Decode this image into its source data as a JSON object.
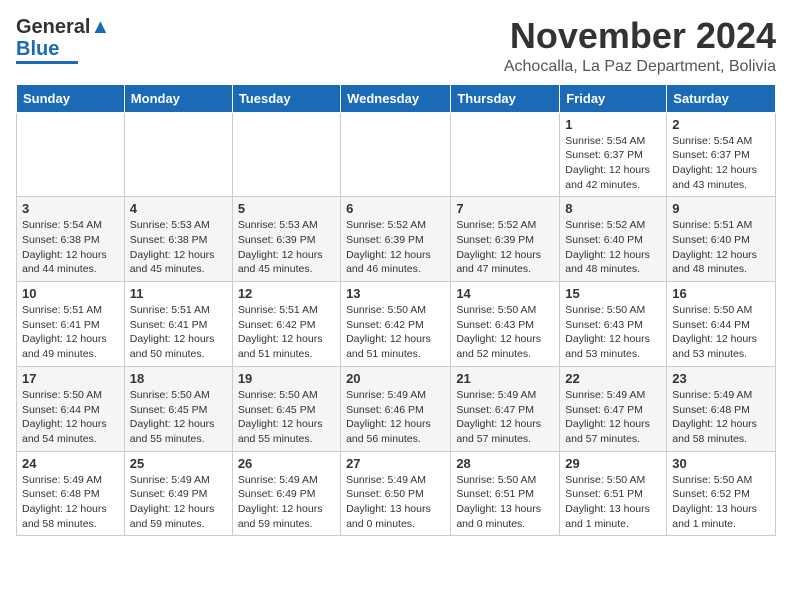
{
  "header": {
    "logo_general": "General",
    "logo_blue": "Blue",
    "month": "November 2024",
    "location": "Achocalla, La Paz Department, Bolivia"
  },
  "days_of_week": [
    "Sunday",
    "Monday",
    "Tuesday",
    "Wednesday",
    "Thursday",
    "Friday",
    "Saturday"
  ],
  "weeks": [
    [
      {
        "day": "",
        "info": ""
      },
      {
        "day": "",
        "info": ""
      },
      {
        "day": "",
        "info": ""
      },
      {
        "day": "",
        "info": ""
      },
      {
        "day": "",
        "info": ""
      },
      {
        "day": "1",
        "info": "Sunrise: 5:54 AM\nSunset: 6:37 PM\nDaylight: 12 hours\nand 42 minutes."
      },
      {
        "day": "2",
        "info": "Sunrise: 5:54 AM\nSunset: 6:37 PM\nDaylight: 12 hours\nand 43 minutes."
      }
    ],
    [
      {
        "day": "3",
        "info": "Sunrise: 5:54 AM\nSunset: 6:38 PM\nDaylight: 12 hours\nand 44 minutes."
      },
      {
        "day": "4",
        "info": "Sunrise: 5:53 AM\nSunset: 6:38 PM\nDaylight: 12 hours\nand 45 minutes."
      },
      {
        "day": "5",
        "info": "Sunrise: 5:53 AM\nSunset: 6:39 PM\nDaylight: 12 hours\nand 45 minutes."
      },
      {
        "day": "6",
        "info": "Sunrise: 5:52 AM\nSunset: 6:39 PM\nDaylight: 12 hours\nand 46 minutes."
      },
      {
        "day": "7",
        "info": "Sunrise: 5:52 AM\nSunset: 6:39 PM\nDaylight: 12 hours\nand 47 minutes."
      },
      {
        "day": "8",
        "info": "Sunrise: 5:52 AM\nSunset: 6:40 PM\nDaylight: 12 hours\nand 48 minutes."
      },
      {
        "day": "9",
        "info": "Sunrise: 5:51 AM\nSunset: 6:40 PM\nDaylight: 12 hours\nand 48 minutes."
      }
    ],
    [
      {
        "day": "10",
        "info": "Sunrise: 5:51 AM\nSunset: 6:41 PM\nDaylight: 12 hours\nand 49 minutes."
      },
      {
        "day": "11",
        "info": "Sunrise: 5:51 AM\nSunset: 6:41 PM\nDaylight: 12 hours\nand 50 minutes."
      },
      {
        "day": "12",
        "info": "Sunrise: 5:51 AM\nSunset: 6:42 PM\nDaylight: 12 hours\nand 51 minutes."
      },
      {
        "day": "13",
        "info": "Sunrise: 5:50 AM\nSunset: 6:42 PM\nDaylight: 12 hours\nand 51 minutes."
      },
      {
        "day": "14",
        "info": "Sunrise: 5:50 AM\nSunset: 6:43 PM\nDaylight: 12 hours\nand 52 minutes."
      },
      {
        "day": "15",
        "info": "Sunrise: 5:50 AM\nSunset: 6:43 PM\nDaylight: 12 hours\nand 53 minutes."
      },
      {
        "day": "16",
        "info": "Sunrise: 5:50 AM\nSunset: 6:44 PM\nDaylight: 12 hours\nand 53 minutes."
      }
    ],
    [
      {
        "day": "17",
        "info": "Sunrise: 5:50 AM\nSunset: 6:44 PM\nDaylight: 12 hours\nand 54 minutes."
      },
      {
        "day": "18",
        "info": "Sunrise: 5:50 AM\nSunset: 6:45 PM\nDaylight: 12 hours\nand 55 minutes."
      },
      {
        "day": "19",
        "info": "Sunrise: 5:50 AM\nSunset: 6:45 PM\nDaylight: 12 hours\nand 55 minutes."
      },
      {
        "day": "20",
        "info": "Sunrise: 5:49 AM\nSunset: 6:46 PM\nDaylight: 12 hours\nand 56 minutes."
      },
      {
        "day": "21",
        "info": "Sunrise: 5:49 AM\nSunset: 6:47 PM\nDaylight: 12 hours\nand 57 minutes."
      },
      {
        "day": "22",
        "info": "Sunrise: 5:49 AM\nSunset: 6:47 PM\nDaylight: 12 hours\nand 57 minutes."
      },
      {
        "day": "23",
        "info": "Sunrise: 5:49 AM\nSunset: 6:48 PM\nDaylight: 12 hours\nand 58 minutes."
      }
    ],
    [
      {
        "day": "24",
        "info": "Sunrise: 5:49 AM\nSunset: 6:48 PM\nDaylight: 12 hours\nand 58 minutes."
      },
      {
        "day": "25",
        "info": "Sunrise: 5:49 AM\nSunset: 6:49 PM\nDaylight: 12 hours\nand 59 minutes."
      },
      {
        "day": "26",
        "info": "Sunrise: 5:49 AM\nSunset: 6:49 PM\nDaylight: 12 hours\nand 59 minutes."
      },
      {
        "day": "27",
        "info": "Sunrise: 5:49 AM\nSunset: 6:50 PM\nDaylight: 13 hours\nand 0 minutes."
      },
      {
        "day": "28",
        "info": "Sunrise: 5:50 AM\nSunset: 6:51 PM\nDaylight: 13 hours\nand 0 minutes."
      },
      {
        "day": "29",
        "info": "Sunrise: 5:50 AM\nSunset: 6:51 PM\nDaylight: 13 hours\nand 1 minute."
      },
      {
        "day": "30",
        "info": "Sunrise: 5:50 AM\nSunset: 6:52 PM\nDaylight: 13 hours\nand 1 minute."
      }
    ]
  ]
}
